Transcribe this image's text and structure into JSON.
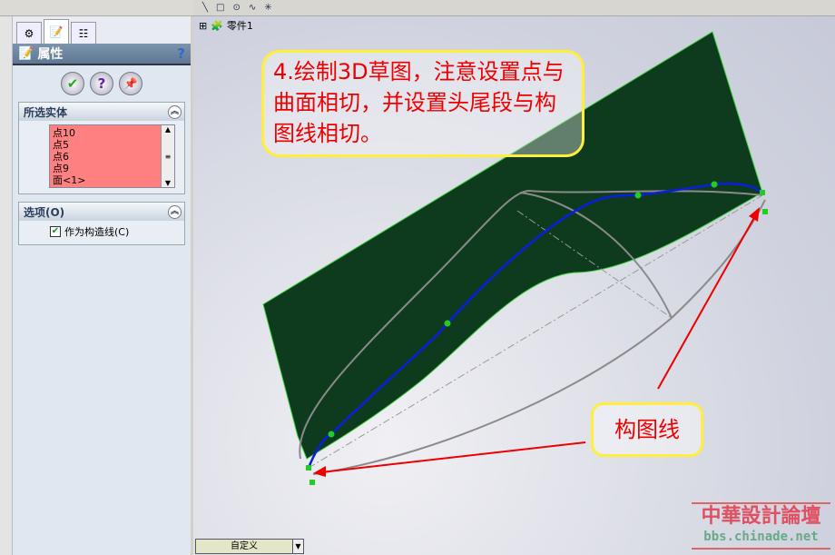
{
  "panel": {
    "tabs": [
      "feature-manager",
      "property-manager",
      "configuration-manager"
    ],
    "title": "属性",
    "buttons": {
      "ok": "✔",
      "help": "?",
      "pin": "📌"
    },
    "selected": {
      "header": "所选实体",
      "items": [
        "点10",
        "点5",
        "点6",
        "点9",
        "面<1>"
      ]
    },
    "options": {
      "header": "选项(O)",
      "construction_label": "作为构造线(C)",
      "construction_checked": true
    }
  },
  "viewport": {
    "tree_root": "零件1",
    "note": "4.绘制3D草图，注意设置点与曲面相切，并设置头尾段与构图线相切。",
    "label": "构图线",
    "combo": "自定义",
    "watermark": {
      "title": "中華設計論壇",
      "url": "bbs.chinade.net"
    },
    "colors": {
      "surface": "#0e3a1e",
      "curve": "#0a1ee0",
      "construction": "#8a8a8a",
      "annotation": "#e00000",
      "note_border": "#ffef3a"
    }
  }
}
